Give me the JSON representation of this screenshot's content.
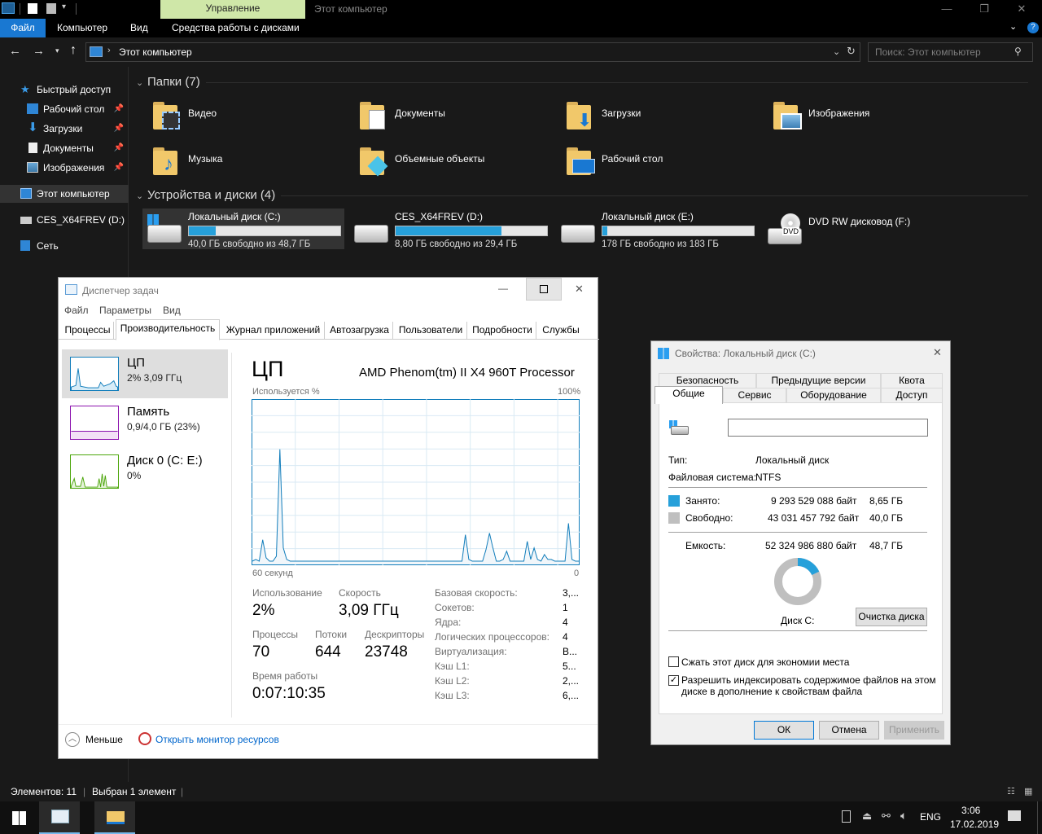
{
  "explorer": {
    "contextual_tab": "Управление",
    "window_title": "Этот компьютер",
    "ribbon_tabs": [
      "Файл",
      "Компьютер",
      "Вид",
      "Средства работы с дисками"
    ],
    "address": "Этот компьютер",
    "search_placeholder": "Поиск: Этот компьютер",
    "nav": {
      "quick_access": "Быстрый доступ",
      "items": [
        "Рабочий стол",
        "Загрузки",
        "Документы",
        "Изображения"
      ],
      "this_pc": "Этот компьютер",
      "drive_d": "CES_X64FREV (D:)",
      "network": "Сеть"
    },
    "folders_header": "Папки (7)",
    "folders": [
      {
        "name": "Видео",
        "icon": "video-folder-icon"
      },
      {
        "name": "Документы",
        "icon": "documents-folder-icon"
      },
      {
        "name": "Загрузки",
        "icon": "downloads-folder-icon"
      },
      {
        "name": "Изображения",
        "icon": "pictures-folder-icon"
      },
      {
        "name": "Музыка",
        "icon": "music-folder-icon"
      },
      {
        "name": "Объемные объекты",
        "icon": "3d-objects-folder-icon"
      },
      {
        "name": "Рабочий стол",
        "icon": "desktop-folder-icon"
      }
    ],
    "devices_header": "Устройства и диски (4)",
    "drives": [
      {
        "name": "Локальный диск (C:)",
        "free": "40,0 ГБ свободно из 48,7 ГБ",
        "used_fraction": 0.18
      },
      {
        "name": "CES_X64FREV (D:)",
        "free": "8,80 ГБ свободно из 29,4 ГБ",
        "used_fraction": 0.7
      },
      {
        "name": "Локальный диск (E:)",
        "free": "178 ГБ свободно из 183 ГБ",
        "used_fraction": 0.03
      }
    ],
    "dvd": {
      "name": "DVD RW дисковод (F:)",
      "badge": "DVD"
    },
    "status": {
      "items": "Элементов: 11",
      "selected": "Выбран 1 элемент"
    }
  },
  "taskmgr": {
    "title": "Диспетчер задач",
    "menu": [
      "Файл",
      "Параметры",
      "Вид"
    ],
    "tabs": [
      "Процессы",
      "Производительность",
      "Журнал приложений",
      "Автозагрузка",
      "Пользователи",
      "Подробности",
      "Службы"
    ],
    "side": [
      {
        "name": "ЦП",
        "value": "2% 3,09 ГГц"
      },
      {
        "name": "Память",
        "value": "0,9/4,0 ГБ (23%)"
      },
      {
        "name": "Диск 0 (C: E:)",
        "value": "0%"
      }
    ],
    "heading": "ЦП",
    "cpu_name": "AMD Phenom(tm) II X4 960T Processor",
    "graph_label": "Используется %",
    "graph_max": "100%",
    "graph_time": "60 секунд",
    "graph_min": "0",
    "stats": {
      "usage_label": "Использование",
      "usage": "2%",
      "speed_label": "Скорость",
      "speed": "3,09 ГГц",
      "proc_label": "Процессы",
      "proc": "70",
      "threads_label": "Потоки",
      "threads": "644",
      "handles_label": "Дескрипторы",
      "handles": "23748",
      "uptime_label": "Время работы",
      "uptime": "0:07:10:35"
    },
    "specs": [
      {
        "k": "Базовая скорость:",
        "v": "3,..."
      },
      {
        "k": "Сокетов:",
        "v": "1"
      },
      {
        "k": "Ядра:",
        "v": "4"
      },
      {
        "k": "Логических процессоров:",
        "v": "4"
      },
      {
        "k": "Виртуализация:",
        "v": "В..."
      },
      {
        "k": "Кэш L1:",
        "v": "5..."
      },
      {
        "k": "Кэш L2:",
        "v": "2,..."
      },
      {
        "k": "Кэш L3:",
        "v": "6,..."
      }
    ],
    "less": "Меньше",
    "monitor": "Открыть монитор ресурсов",
    "cpu_history": [
      2,
      3,
      2,
      15,
      4,
      2,
      2,
      5,
      70,
      10,
      3,
      2,
      2,
      2,
      2,
      2,
      2,
      2,
      2,
      2,
      2,
      2,
      2,
      2,
      2,
      2,
      2,
      2,
      2,
      2,
      2,
      2,
      2,
      2,
      2,
      2,
      2,
      2,
      2,
      2,
      2,
      2,
      2,
      2,
      2,
      2,
      2,
      2,
      2,
      2,
      2,
      2,
      2,
      2,
      2,
      2,
      2,
      2,
      2,
      2,
      2,
      2,
      18,
      3,
      2,
      2,
      2,
      2,
      9,
      19,
      10,
      2,
      2,
      3,
      8,
      2,
      2,
      2,
      2,
      2,
      14,
      3,
      10,
      3,
      2,
      6,
      3,
      3,
      2,
      2,
      2,
      2,
      25,
      3,
      2,
      2
    ]
  },
  "props": {
    "title": "Свойства: Локальный диск (C:)",
    "tabs_row1": [
      "Безопасность",
      "Предыдущие версии",
      "Квота"
    ],
    "tabs_row2": [
      "Общие",
      "Сервис",
      "Оборудование",
      "Доступ"
    ],
    "type_label": "Тип:",
    "type": "Локальный диск",
    "fs_label": "Файловая система:",
    "fs": "NTFS",
    "used_label": "Занято:",
    "used_bytes": "9 293 529 088 байт",
    "used_gb": "8,65 ГБ",
    "free_label": "Свободно:",
    "free_bytes": "43 031 457 792 байт",
    "free_gb": "40,0 ГБ",
    "cap_label": "Емкость:",
    "cap_bytes": "52 324 986 880 байт",
    "cap_gb": "48,7 ГБ",
    "used_fraction": 0.18,
    "disk_label": "Диск C:",
    "cleanup": "Очистка диска",
    "compress": "Сжать этот диск для экономии места",
    "index_line1": "Разрешить индексировать содержимое файлов на этом",
    "index_line2": "диске в дополнение к свойствам файла",
    "ok": "ОК",
    "cancel": "Отмена",
    "apply": "Применить",
    "colors": {
      "used": "#26a0da",
      "free": "#bfbfbf"
    }
  },
  "taskbar": {
    "lang": "ENG",
    "time": "3:06",
    "date": "17.02.2019"
  }
}
